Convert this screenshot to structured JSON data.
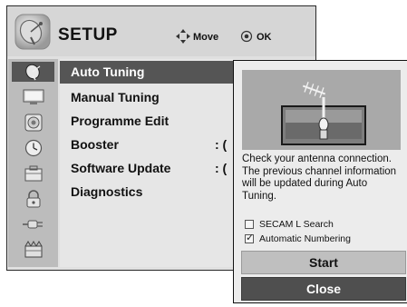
{
  "header": {
    "title": "SETUP",
    "icon": "satellite-dish-icon",
    "hint_move": "Move",
    "hint_ok": "OK"
  },
  "sidebar": {
    "items": [
      {
        "icon": "satellite-dish-icon",
        "active": true
      },
      {
        "icon": "picture-icon",
        "active": false
      },
      {
        "icon": "audio-icon",
        "active": false
      },
      {
        "icon": "clock-icon",
        "active": false
      },
      {
        "icon": "option-icon",
        "active": false
      },
      {
        "icon": "lock-icon",
        "active": false
      },
      {
        "icon": "input-icon",
        "active": false
      },
      {
        "icon": "usb-icon",
        "active": false
      }
    ]
  },
  "menu": {
    "items": [
      {
        "label": "Auto Tuning",
        "selected": true,
        "value": ""
      },
      {
        "label": "Manual Tuning",
        "selected": false,
        "value": ""
      },
      {
        "label": "Programme Edit",
        "selected": false,
        "value": ""
      },
      {
        "label": "Booster",
        "selected": false,
        "value": ": ("
      },
      {
        "label": "Software Update",
        "selected": false,
        "value": ": ("
      },
      {
        "label": "Diagnostics",
        "selected": false,
        "value": ""
      }
    ]
  },
  "popup": {
    "illustration": "antenna-connection-icon",
    "message": "Check your antenna connection. The previous channel information will be updated during Auto Tuning.",
    "options": [
      {
        "label": "SECAM L Search",
        "checked": false
      },
      {
        "label": "Automatic Numbering",
        "checked": true
      }
    ],
    "start_label": "Start",
    "close_label": "Close"
  },
  "colors": {
    "selected_bg": "#555555",
    "panel_bg": "#e0e0e0",
    "close_bg": "#4f4f4f",
    "start_bg": "#bfbfbf"
  }
}
